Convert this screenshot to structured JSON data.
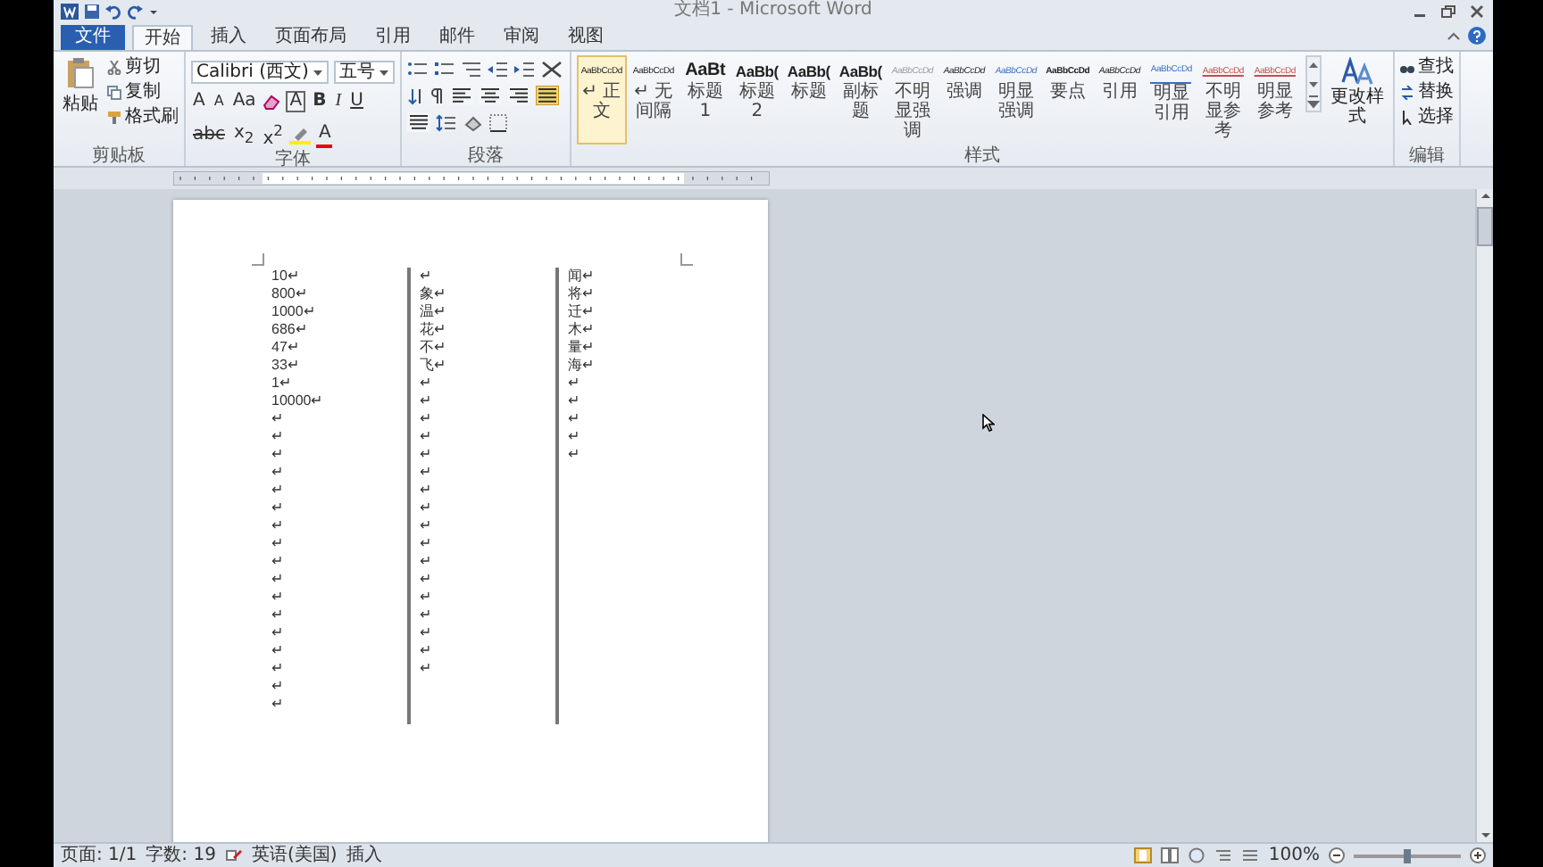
{
  "window": {
    "title": "文档1 - Microsoft Word"
  },
  "tabs": [
    {
      "label": "文件",
      "kind": "file",
      "selected": false
    },
    {
      "label": "开始",
      "kind": "tab",
      "selected": true
    },
    {
      "label": "插入",
      "kind": "tab",
      "selected": false
    },
    {
      "label": "页面布局",
      "kind": "tab",
      "selected": false
    },
    {
      "label": "引用",
      "kind": "tab",
      "selected": false
    },
    {
      "label": "邮件",
      "kind": "tab",
      "selected": false
    },
    {
      "label": "审阅",
      "kind": "tab",
      "selected": false
    },
    {
      "label": "视图",
      "kind": "tab",
      "selected": false
    }
  ],
  "clipboard": {
    "label": "剪贴板",
    "paste": "粘贴",
    "items": [
      "剪切",
      "复制",
      "格式刷"
    ]
  },
  "font": {
    "label": "字体",
    "family": "Calibri (西文)",
    "size": "五号",
    "grow": "A",
    "shrink": "A",
    "case": "Aa",
    "bold": "B",
    "italic": "I",
    "underline": "U",
    "strike": "abc",
    "subscript": "x$_{2}$",
    "superscript": "x$^{2}$",
    "font_color": "A",
    "border_char": "A"
  },
  "paragraph": {
    "label": "段落",
    "alignment": [
      {
        "selected": false
      },
      {
        "selected": false
      },
      {
        "selected": false
      },
      {
        "selected": true
      },
      {
        "selected": false
      }
    ]
  },
  "styles": {
    "label": "样式",
    "change": "更改样式",
    "items": [
      {
        "preview": "AaBbCcDd",
        "label": "↵ 正文",
        "kind": "normal",
        "selected": true
      },
      {
        "preview": "AaBbCcDd",
        "label": "↵ 无间隔",
        "kind": "normal",
        "selected": false
      },
      {
        "preview": "AaBt",
        "label": "标题 1",
        "kind": "heading",
        "selected": false
      },
      {
        "preview": "AaBb(",
        "label": "标题 2",
        "kind": "heading2",
        "selected": false
      },
      {
        "preview": "AaBb(",
        "label": "标题",
        "kind": "heading2",
        "selected": false
      },
      {
        "preview": "AaBb(",
        "label": "副标题",
        "kind": "heading2",
        "selected": false
      },
      {
        "preview": "AaBbCcDd",
        "label": "不明显强调",
        "kind": "subtle",
        "selected": false
      },
      {
        "preview": "AaBbCcDd",
        "label": "强调",
        "kind": "emphasis",
        "selected": false
      },
      {
        "preview": "AaBbCcDd",
        "label": "明显强调",
        "kind": "intense",
        "selected": false
      },
      {
        "preview": "AaBbCcDd",
        "label": "要点",
        "kind": "strong",
        "selected": false
      },
      {
        "preview": "AaBbCcDd",
        "label": "引用",
        "kind": "quote",
        "selected": false
      },
      {
        "preview": "AaBbCcDd",
        "label": "明显引用",
        "kind": "intense-quote",
        "selected": false
      },
      {
        "preview": "AaBbCcDd",
        "label": "不明显参考",
        "kind": "reference",
        "selected": false
      },
      {
        "preview": "AaBbCcDd",
        "label": "明显参考",
        "kind": "reference",
        "selected": false
      }
    ]
  },
  "editing": {
    "label": "编辑",
    "items": [
      "查找",
      "替换",
      "选择"
    ]
  },
  "document": {
    "columns": [
      {
        "lines": [
          "10↵",
          "800↵",
          "1000↵",
          "686↵",
          "47↵",
          "33↵",
          "1↵",
          "10000↵",
          "↵",
          "↵",
          "↵",
          "↵",
          "↵",
          "↵",
          "↵",
          "↵",
          "↵",
          "↵",
          "↵",
          "↵",
          "↵",
          "↵",
          "↵",
          "↵",
          "↵"
        ]
      },
      {
        "lines": [
          "↵",
          "象↵",
          "温↵",
          "花↵",
          "不↵",
          "飞↵",
          "↵",
          "↵",
          "↵",
          "↵",
          "↵",
          "↵",
          "↵",
          "↵",
          "↵",
          "↵",
          "↵",
          "↵",
          "↵",
          "↵",
          "↵",
          "↵",
          "↵"
        ]
      },
      {
        "lines": [
          "闻↵",
          "将↵",
          "迁↵",
          "木↵",
          "量↵",
          "海↵",
          "↵",
          "↵",
          "↵",
          "↵",
          "↵"
        ]
      }
    ]
  },
  "status_bar": {
    "page": "页面: 1/1",
    "words": "字数: 19",
    "language": "英语(美国)",
    "mode": "插入",
    "zoom": "100%",
    "zoom_slider": {
      "level": 0.5
    }
  }
}
